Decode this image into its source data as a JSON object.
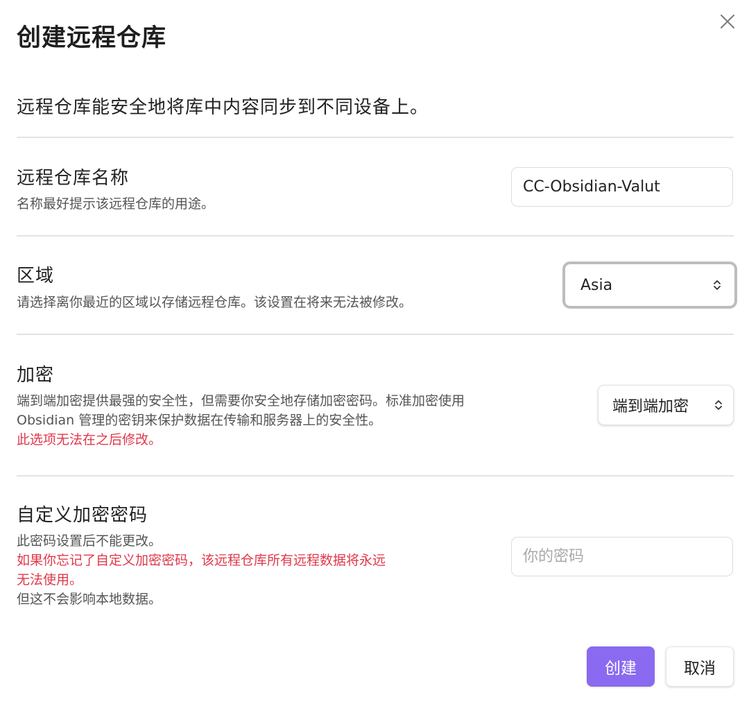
{
  "dialog": {
    "title": "创建远程仓库",
    "intro": "远程仓库能安全地将库中内容同步到不同设备上。",
    "close_icon": "close-icon"
  },
  "vault_name": {
    "label": "远程仓库名称",
    "description": "名称最好提示该远程仓库的用途。",
    "value": "CC-Obsidian-Valut"
  },
  "region": {
    "label": "区域",
    "description": "请选择离你最近的区域以存储远程仓库。该设置在将来无法被修改。",
    "selected": "Asia",
    "icon": "chevron-updown-icon"
  },
  "encryption": {
    "label": "加密",
    "description_line1": "端到端加密提供最强的安全性，但需要你安全地存储加密密码。标准加密使用",
    "description_line2": "Obsidian 管理的密钥来保护数据在传输和服务器上的安全性。",
    "warning": "此选项无法在之后修改。",
    "selected": "端到端加密",
    "icon": "chevron-updown-icon"
  },
  "custom_password": {
    "label": "自定义加密密码",
    "description_line1": "此密码设置后不能更改。",
    "warning_line1": "如果你忘记了自定义加密密码，该远程仓库所有远程数据将永远",
    "warning_line2": "无法使用。",
    "description_line2": "但这不会影响本地数据。",
    "placeholder": "你的密码"
  },
  "actions": {
    "create_label": "创建",
    "cancel_label": "取消"
  },
  "colors": {
    "accent": "#8a6af0",
    "warning": "#e0384a",
    "divider": "#e3e3e3"
  }
}
